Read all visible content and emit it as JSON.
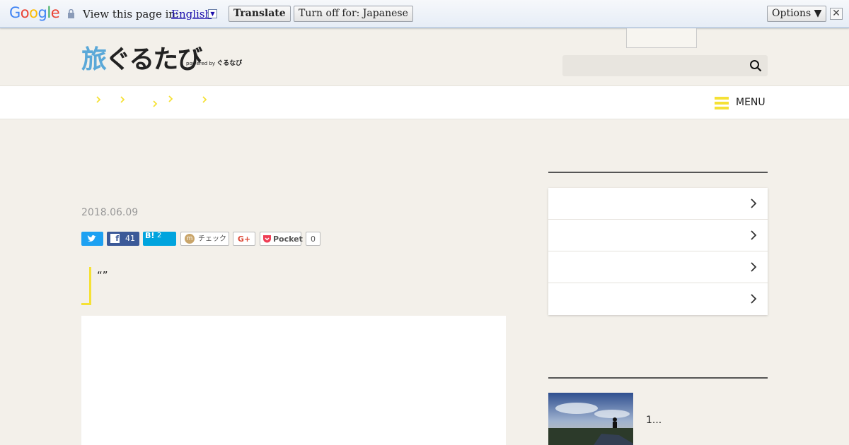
{
  "translate_bar": {
    "logo": "Google",
    "prompt": "View this page in:",
    "language": "English",
    "translate_label": "Translate",
    "turnoff_label": "Turn off for: Japanese",
    "options_label": "Options ▼",
    "close_label": "✕"
  },
  "header": {
    "logo_text": "旅ぐるたび",
    "logo_sub_prefix": "powered by",
    "logo_sub_brand": "ぐるなび",
    "search_placeholder": ""
  },
  "nav": {
    "menu_label": "MENU"
  },
  "article": {
    "title": "",
    "date": "2018.06.09",
    "quote": "“”"
  },
  "share": {
    "facebook_count": "41",
    "hatena_label": "B!",
    "hatena_count": "2",
    "check_label": "チェック",
    "gplus_label": "G+",
    "pocket_label": "Pocket",
    "pocket_count": "0"
  },
  "sidebar": {
    "items": [
      "",
      "",
      "",
      ""
    ],
    "ranking_text": "1..."
  },
  "colors": {
    "accent_yellow": "#f5e135",
    "twitter": "#1da1f2",
    "facebook": "#3b5998",
    "hatena": "#00a4de",
    "background": "#f3f0ea"
  }
}
